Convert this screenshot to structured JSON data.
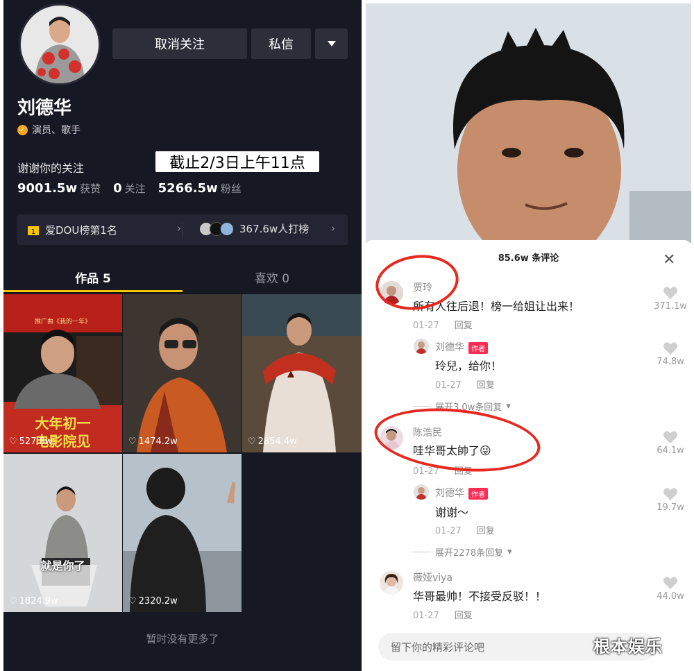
{
  "profile": {
    "name": "刘德华",
    "verification": "演员、歌手",
    "unfollow_label": "取消关注",
    "message_label": "私信",
    "signature": "谢谢你的关注",
    "note_overlay": "截止2/3日上午11点",
    "stats": {
      "likes_value": "9001.5w",
      "likes_label": "获赞",
      "following_value": "0",
      "following_label": "关注",
      "fans_value": "5266.5w",
      "fans_label": "粉丝"
    },
    "rank": {
      "rank_label": "爱DOU榜第1名",
      "supporters_label": "367.6w人打榜"
    },
    "tabs": [
      {
        "label": "作品 5"
      },
      {
        "label": "喜欢 0"
      }
    ],
    "videos": [
      {
        "likes": "527.8w",
        "caption_top": "推广曲《我的一年》",
        "caption_bottom_1": "大年初一",
        "caption_bottom_2": "电影院见"
      },
      {
        "likes": "1474.2w"
      },
      {
        "likes": "2854.4w"
      },
      {
        "likes": "1824.9w",
        "caption": "就是你了"
      },
      {
        "likes": "2320.2w"
      }
    ],
    "no_more": "暂时没有更多了"
  },
  "comments_panel": {
    "title": "85.6w 条评论",
    "input_placeholder": "留下你的精彩评论吧",
    "author_tag": "作者",
    "comments": [
      {
        "user": "贾玲",
        "text": "所有人往后退！榜一给姐让出来！",
        "date": "01-27",
        "reply_label": "回复",
        "likes": "371.1w",
        "replies": [
          {
            "user": "刘德华",
            "text": "玲兒，给你！",
            "date": "01-27",
            "reply_label": "回复",
            "likes": "74.8w"
          }
        ],
        "expand": "展开3.0w条回复"
      },
      {
        "user": "陈浩民",
        "text": "哇华哥太帥了",
        "emoji": "😜",
        "date": "01-27",
        "reply_label": "回复",
        "likes": "64.1w",
        "replies": [
          {
            "user": "刘德华",
            "text": "谢谢～",
            "date": "01-27",
            "reply_label": "回复",
            "likes": "19.7w"
          }
        ],
        "expand": "展开2278条回复"
      },
      {
        "user": "薇娅viya",
        "text": "华哥最帅！不接受反驳！！",
        "date": "01-27",
        "reply_label": "回复",
        "likes": "44.0w"
      }
    ]
  },
  "watermark": "根本娱乐",
  "colors": {
    "accent_yellow": "#f7c400",
    "author_red": "#fe2c55",
    "annotation_red": "#e8281e",
    "dark_bg": "#161823"
  }
}
